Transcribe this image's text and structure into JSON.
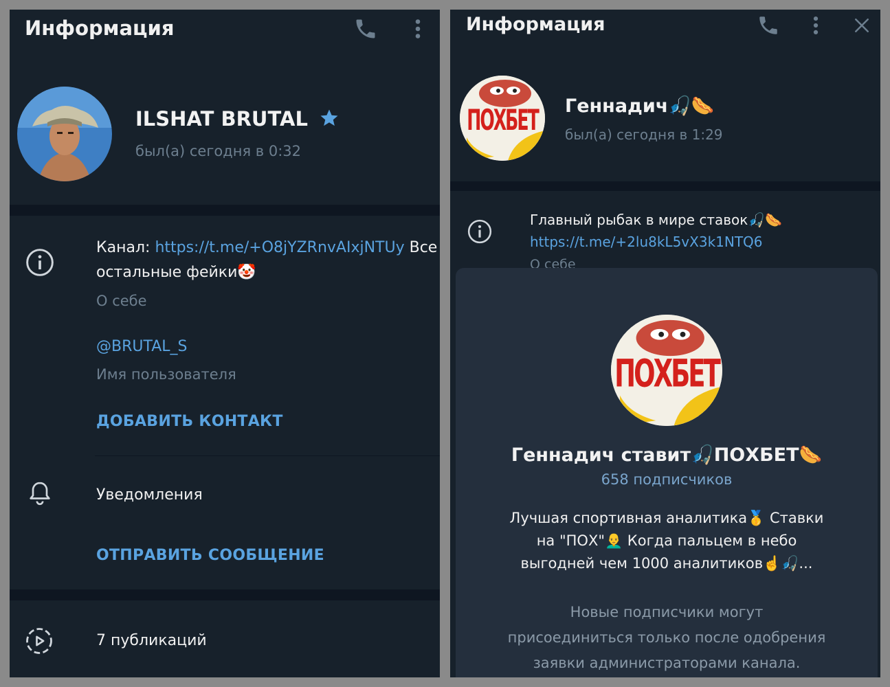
{
  "left": {
    "header_title": "Информация",
    "profile": {
      "name": "ILSHAT BRUTAL",
      "status": "был(а) сегодня в 0:32"
    },
    "bio": {
      "prefix": "Канал: ",
      "link": "https://t.me/+O8jYZRnvAIxjNTUy",
      "suffix": " Все",
      "line2": "остальные фейки🤡",
      "label": "О себе"
    },
    "username": {
      "value": "@BRUTAL_S",
      "label": "Имя пользователя"
    },
    "add_contact": "ДОБАВИТЬ КОНТАКТ",
    "notifications": "Уведомления",
    "send_message": "ОТПРАВИТЬ СООБЩЕНИЕ",
    "publications": "7 публикаций"
  },
  "right": {
    "header_title": "Информация",
    "profile": {
      "name": "Геннадич🎣🌭",
      "status": "был(а) сегодня в 1:29",
      "avatar_text": "ПОХБЕТ"
    },
    "bio": {
      "line1": "Главный рыбак в мире ставок🎣🌭",
      "link": "https://t.me/+2lu8kL5vX3k1NTQ6",
      "label": "О себе"
    },
    "popup": {
      "avatar_text": "ПОХБЕТ",
      "title": "Геннадич ставит🎣ПОХБЕТ🌭",
      "subscribers": "658 подписчиков",
      "desc_line1": "Лучшая спортивная аналитика🥇 Ставки",
      "desc_line2": "на \"ПОХ\"👨‍🦲 Когда пальцем в небо",
      "desc_line3": "выгодней чем 1000 аналитиков☝️🎣...",
      "note_line1": "Новые подписчики могут",
      "note_line2": "присоединиться только после одобрения",
      "note_line3": "заявки администраторами канала."
    }
  },
  "colors": {
    "panel_bg": "#17212b",
    "separator": "#0e1621",
    "accent": "#5aa3e0",
    "muted": "#6d7f8f",
    "popup_bg": "#242f3d"
  }
}
